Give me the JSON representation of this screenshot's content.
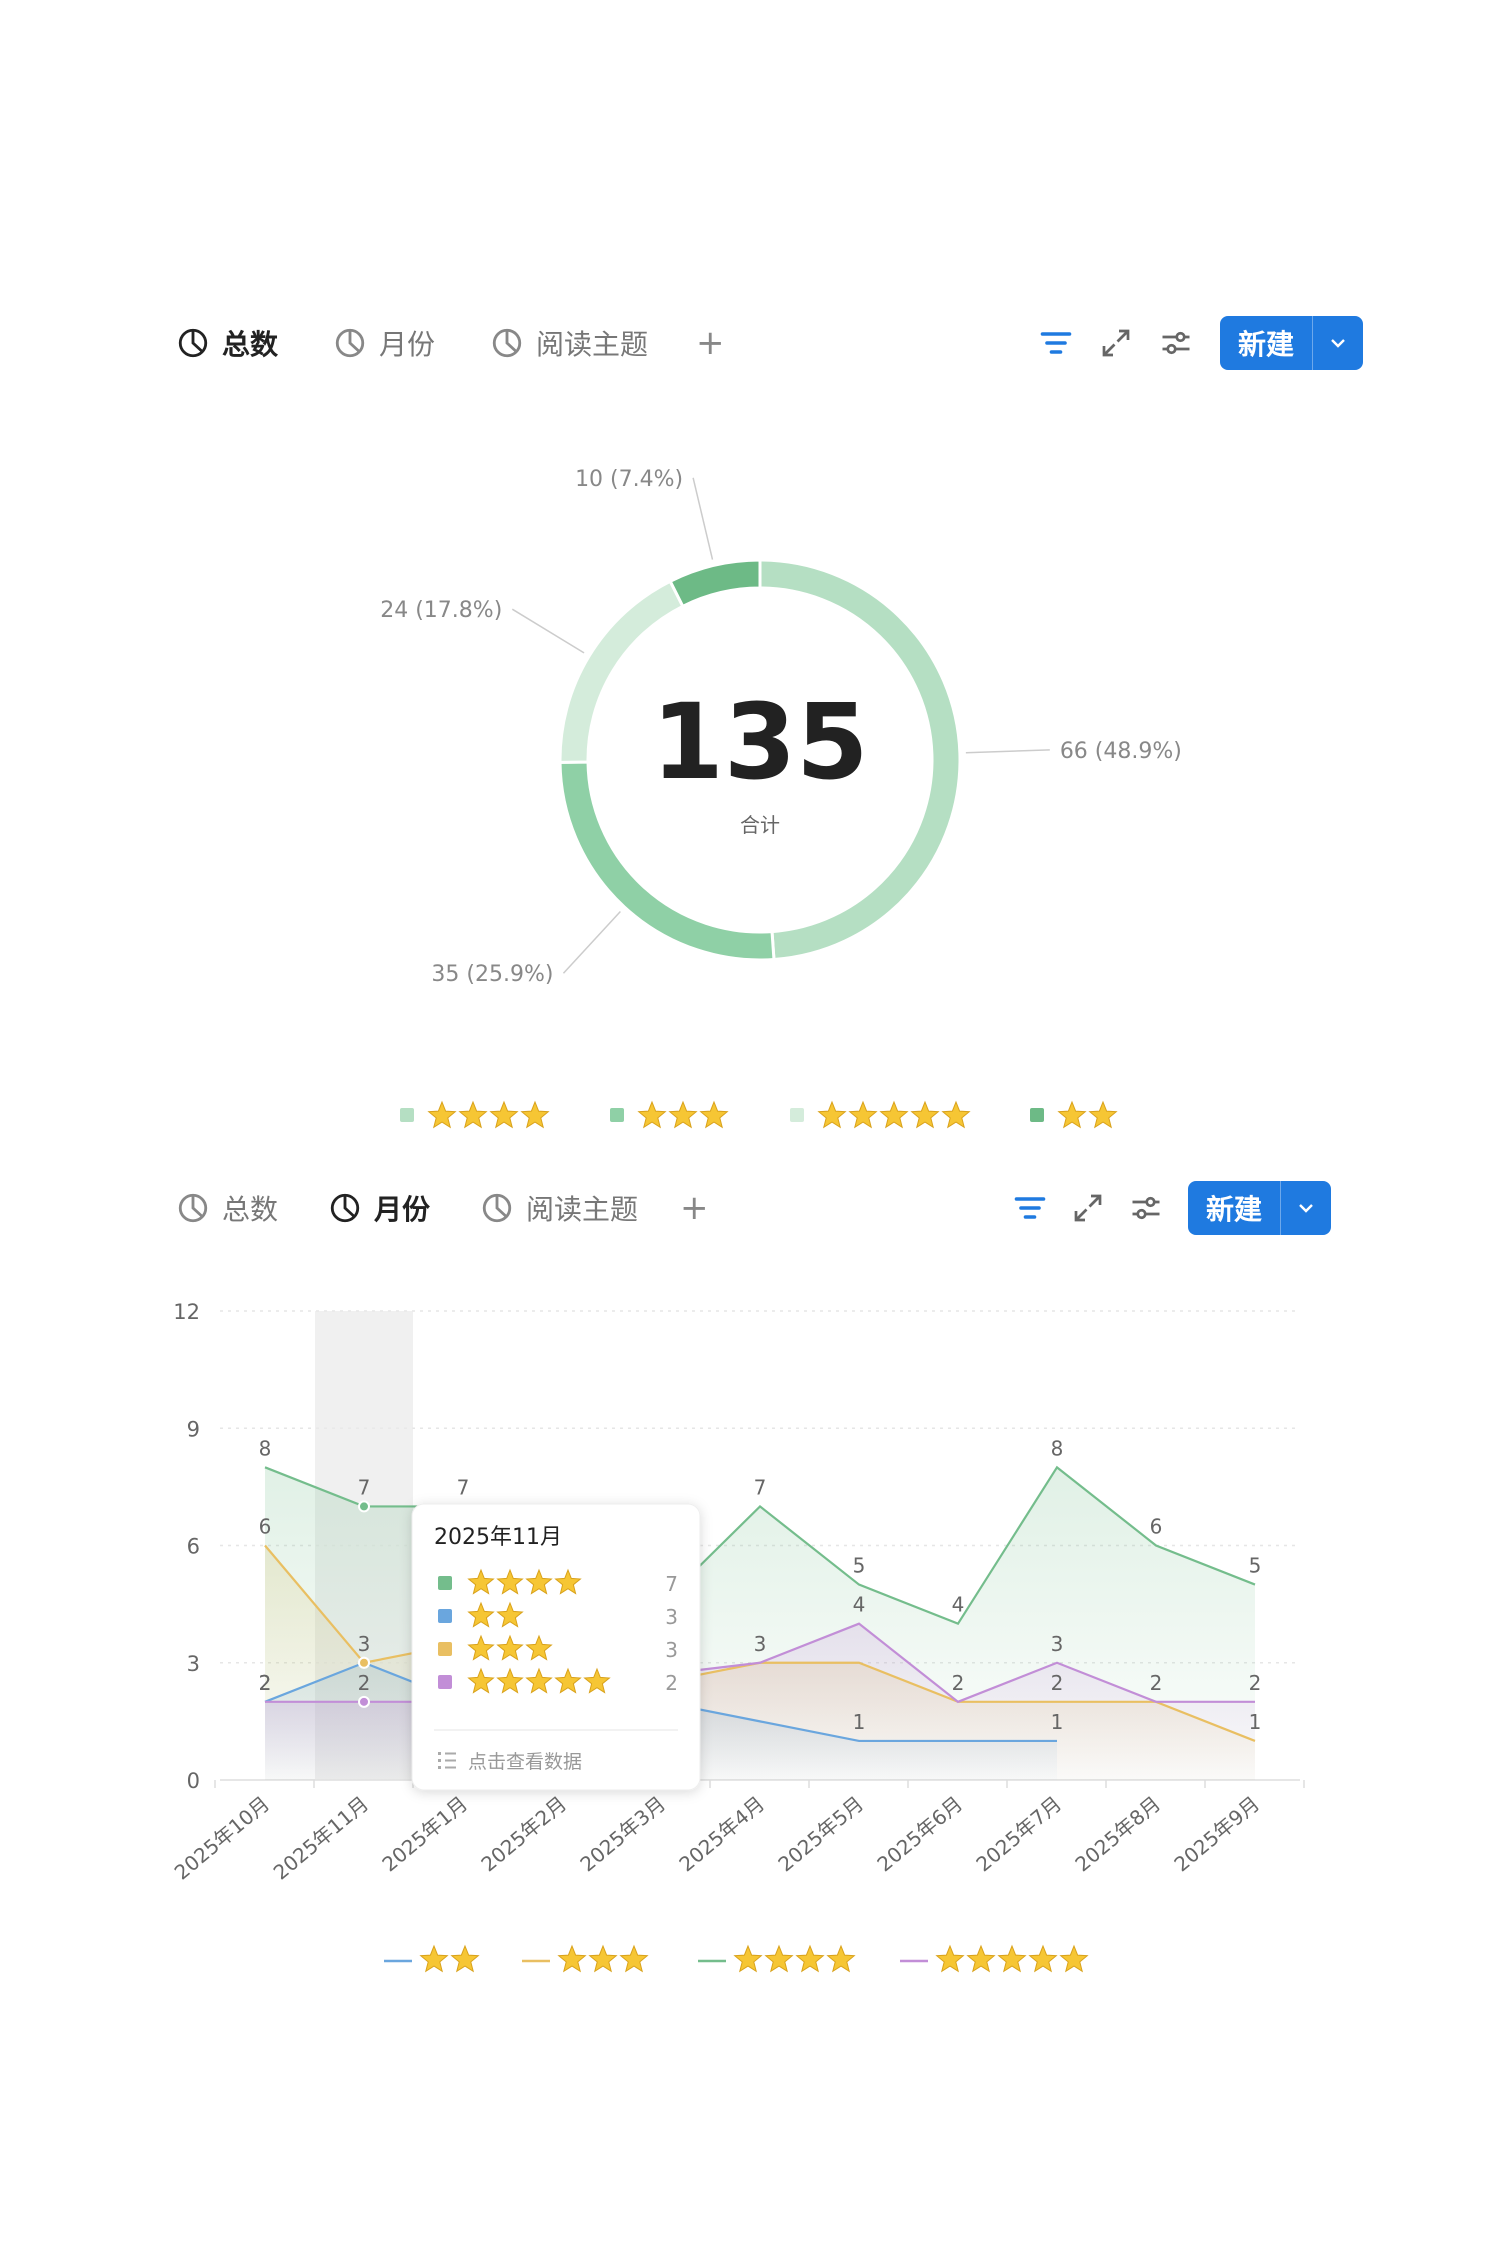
{
  "toolbar1": {
    "tabs": [
      {
        "label": "总数",
        "active": true
      },
      {
        "label": "月份",
        "active": false
      },
      {
        "label": "阅读主题",
        "active": false
      }
    ],
    "add_icon": "plus-icon",
    "new_label": "新建",
    "icons": [
      "filter-icon",
      "expand-icon",
      "settings-icon",
      "chevron-down-icon"
    ]
  },
  "toolbar2": {
    "tabs": [
      {
        "label": "总数",
        "active": false
      },
      {
        "label": "月份",
        "active": true
      },
      {
        "label": "阅读主题",
        "active": false
      }
    ],
    "add_icon": "plus-icon",
    "new_label": "新建",
    "icons": [
      "filter-icon",
      "expand-icon",
      "settings-icon",
      "chevron-down-icon"
    ]
  },
  "colors": {
    "accent": "#1f7ae0",
    "donut": [
      "#b5dfc3",
      "#8fd0a6",
      "#d4ecdb",
      "#6dba86"
    ],
    "line_2": "#6aa6de",
    "line_3": "#e9bf62",
    "line_4": "#74bd8c",
    "line_5": "#c28ed7"
  },
  "chart_data": [
    {
      "type": "pie",
      "style": "donut",
      "total": "135",
      "total_label": "合计",
      "slices": [
        {
          "label": "⭐⭐⭐⭐",
          "stars": 4,
          "value": 66,
          "text": "66 (48.9%)"
        },
        {
          "label": "⭐⭐⭐",
          "stars": 3,
          "value": 35,
          "text": "35 (25.9%)"
        },
        {
          "label": "⭐⭐⭐⭐⭐",
          "stars": 5,
          "value": 24,
          "text": "24 (17.8%)"
        },
        {
          "label": "⭐⭐",
          "stars": 2,
          "value": 10,
          "text": "10 (7.4%)"
        }
      ],
      "legend_position": "bottom"
    },
    {
      "type": "line",
      "categories": [
        "2025年10月",
        "2025年11月",
        "2025年1月",
        "2025年2月",
        "2025年3月",
        "2025年4月",
        "2025年5月",
        "2025年6月",
        "2025年7月",
        "2025年8月",
        "2025年9月"
      ],
      "ylim": [
        0,
        12
      ],
      "yticks": [
        "0",
        "3",
        "6",
        "9",
        "12"
      ],
      "grid": true,
      "legend_position": "bottom",
      "series": [
        {
          "name": "⭐⭐",
          "stars": 2,
          "values": [
            2,
            3,
            2,
            null,
            2,
            1.5,
            1,
            1,
            1,
            null,
            null
          ],
          "labels": [
            "2",
            "3",
            "",
            "",
            "",
            "",
            "1",
            "",
            "1",
            "",
            ""
          ]
        },
        {
          "name": "⭐⭐⭐",
          "stars": 3,
          "values": [
            6,
            3,
            3.5,
            null,
            2.5,
            3,
            3,
            2,
            2,
            2,
            1
          ],
          "labels": [
            "6",
            "",
            "",
            "",
            "",
            "",
            "",
            "",
            "2",
            "2",
            "1"
          ]
        },
        {
          "name": "⭐⭐⭐⭐",
          "stars": 4,
          "values": [
            8,
            7,
            7,
            null,
            4.5,
            7,
            5,
            4,
            8,
            6,
            5
          ],
          "labels": [
            "8",
            "7",
            "7",
            "",
            "",
            "7",
            "5",
            "4",
            "8",
            "6",
            "5"
          ]
        },
        {
          "name": "⭐⭐⭐⭐⭐",
          "stars": 5,
          "values": [
            2,
            2,
            2,
            null,
            2.7,
            3,
            4,
            2,
            3,
            2,
            2
          ],
          "labels": [
            "2",
            "2",
            "",
            "",
            "",
            "3",
            "4",
            "2",
            "3",
            "",
            "2"
          ]
        }
      ],
      "highlight_index": 1,
      "tooltip": {
        "title": "2025年11月",
        "rows": [
          {
            "stars": 4,
            "label": "⭐⭐⭐⭐",
            "value": "7"
          },
          {
            "stars": 2,
            "label": "⭐⭐",
            "value": "3"
          },
          {
            "stars": 3,
            "label": "⭐⭐⭐",
            "value": "3"
          },
          {
            "stars": 5,
            "label": "⭐⭐⭐⭐⭐",
            "value": "2"
          }
        ],
        "action": "点击查看数据",
        "action_icon": "list-icon"
      }
    }
  ]
}
